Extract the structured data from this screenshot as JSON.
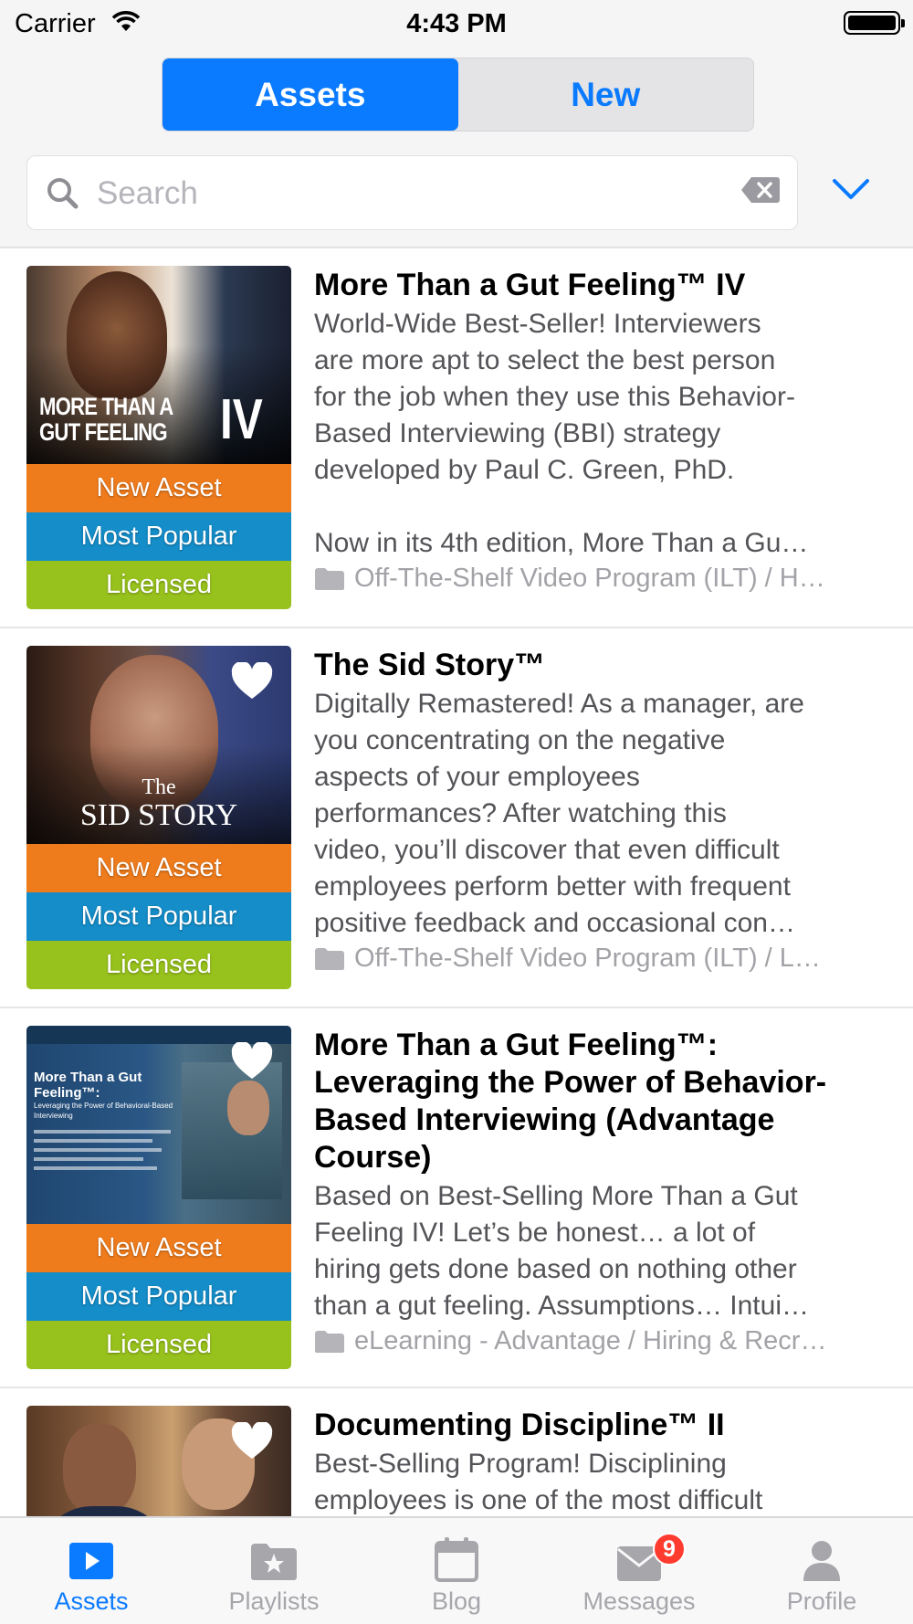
{
  "status_bar": {
    "carrier": "Carrier",
    "time": "4:43 PM"
  },
  "segmented": {
    "left": "Assets",
    "right": "New",
    "selected": "Assets"
  },
  "search": {
    "placeholder": "Search",
    "value": ""
  },
  "colors": {
    "accent": "#0a7aff",
    "tag_new": "#ee7b1c",
    "tag_popular": "#148dc9",
    "tag_licensed": "#97c11c",
    "badge": "#ff3b30"
  },
  "items": [
    {
      "title": "More Than a Gut Feeling™ IV",
      "desc": [
        "World-Wide Best-Seller! Interviewers",
        "are more apt to select the best person",
        "for the job when they use this Behavior-",
        "Based Interviewing (BBI) strategy",
        "developed by Paul C. Green, PhD.",
        "",
        "Now in its 4th edition, More Than a Gu…"
      ],
      "category": "Off-The-Shelf Video Program (ILT) / H…",
      "thumb_text": [
        "MORE THAN A",
        "GUT FEELING",
        "IV"
      ],
      "tags": [
        "New Asset",
        "Most Popular",
        "Licensed"
      ],
      "favorite": false
    },
    {
      "title": "The Sid Story™",
      "desc": [
        "Digitally Remastered! As a manager, are",
        "you concentrating on the negative",
        "aspects of your employees",
        "performances? After watching this",
        "video, you’ll discover that even difficult",
        "employees perform better with frequent",
        "positive feedback and occasional con…"
      ],
      "category": "Off-The-Shelf Video Program (ILT) / L…",
      "thumb_text": [
        "The",
        "SID STORY"
      ],
      "tags": [
        "New Asset",
        "Most Popular",
        "Licensed"
      ],
      "favorite": true
    },
    {
      "title": "More Than a Gut Feeling™: Leveraging the Power of Behavior-Based Interviewing (Advantage Course)",
      "title_lines": [
        "More Than a Gut Feeling™:",
        "Leveraging the Power of Behavior-",
        "Based Interviewing (Advantage",
        "Course)"
      ],
      "desc": [
        "Based on Best-Selling More Than a Gut",
        "Feeling IV! Let’s be honest… a lot of",
        "hiring gets done based on nothing other",
        "than a gut feeling. Assumptions… Intui…"
      ],
      "category": "eLearning - Advantage / Hiring & Recr…",
      "thumb_text": [
        "More Than a Gut Feeling™:",
        "Leveraging the Power of Behavioral-Based Interviewing"
      ],
      "tags": [
        "New Asset",
        "Most Popular",
        "Licensed"
      ],
      "favorite": true
    },
    {
      "title": "Documenting Discipline™ II",
      "desc": [
        "Best-Selling Program! Disciplining",
        "employees is one of the most difficult"
      ],
      "favorite": true
    }
  ],
  "tabbar": {
    "tabs": [
      {
        "label": "Assets",
        "icon": "play-icon",
        "active": true
      },
      {
        "label": "Playlists",
        "icon": "folder-star-icon"
      },
      {
        "label": "Blog",
        "icon": "calendar-icon"
      },
      {
        "label": "Messages",
        "icon": "envelope-icon",
        "badge": "9"
      },
      {
        "label": "Profile",
        "icon": "person-icon"
      }
    ]
  }
}
